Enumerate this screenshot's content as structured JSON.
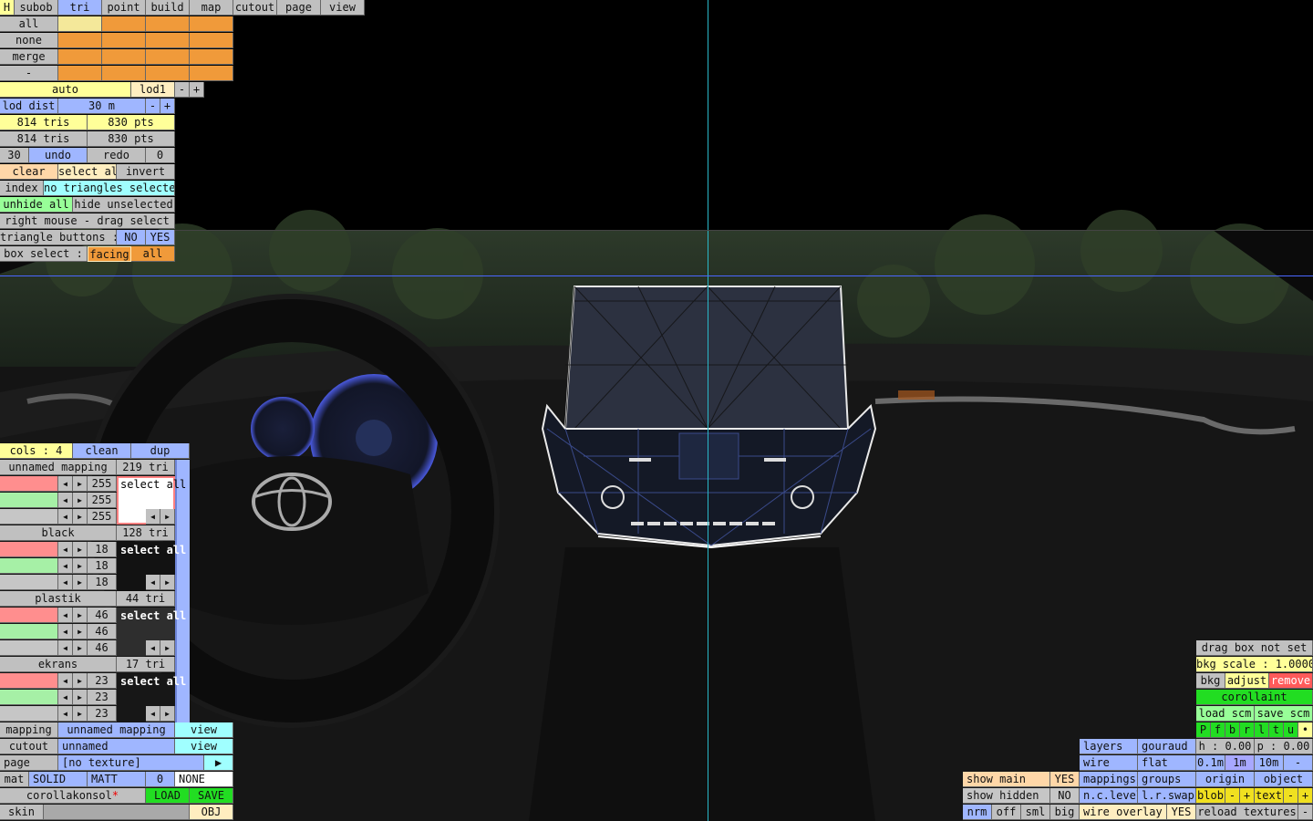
{
  "menu": {
    "h": "H",
    "subob": "subob",
    "tri": "tri",
    "point": "point",
    "build": "build",
    "map": "map",
    "cutout": "cutout",
    "page": "page",
    "view": "view"
  },
  "select_list": [
    "all",
    "none",
    "merge",
    "-"
  ],
  "lod": {
    "auto": "auto",
    "lod1": "lod1",
    "minus": "-",
    "plus": "+",
    "dist_label": "lod dist",
    "dist_value": "30 m"
  },
  "stats": {
    "tris1": "814 tris",
    "pts1": "830 pts",
    "tris2": "814 tris",
    "pts2": "830 pts"
  },
  "undo_row": {
    "left_count": "30",
    "undo": "undo",
    "redo": "redo",
    "right_count": "0"
  },
  "select_row": {
    "clear": "clear",
    "select_all": "select all",
    "invert": "invert"
  },
  "index_row": {
    "index": "index",
    "status": "no triangles selected"
  },
  "hide_row": {
    "unhide_all": "unhide all",
    "hide_unselected": "hide unselected"
  },
  "drag_hint": "right mouse - drag select",
  "tri_buttons": {
    "label": "triangle buttons :",
    "no": "NO",
    "yes": "YES"
  },
  "box_select": {
    "label": "box select :",
    "facing": "facing",
    "all": "all"
  },
  "cols_row": {
    "cols": "cols : 4",
    "clean": "clean",
    "dup": "dup"
  },
  "materials": [
    {
      "name": "unnamed mapping",
      "count": "219 tri",
      "r": "255",
      "g": "255",
      "b": "255",
      "swatch": "#ffffff",
      "select": "select all"
    },
    {
      "name": "black",
      "count": "128 tri",
      "r": "18",
      "g": "18",
      "b": "18",
      "swatch": "#121212",
      "select": "select all"
    },
    {
      "name": "plastik",
      "count": "44 tri",
      "r": "46",
      "g": "46",
      "b": "46",
      "swatch": "#2e2e2e",
      "select": "select all"
    },
    {
      "name": "ekrans",
      "count": "17 tri",
      "r": "23",
      "g": "23",
      "b": "23",
      "swatch": "#171717",
      "select": "select all"
    }
  ],
  "bottom_left": {
    "mapping_label": "mapping",
    "mapping_value": "unnamed mapping",
    "mapping_view": "view",
    "cutout_label": "cutout",
    "cutout_value": "unnamed",
    "cutout_view": "view",
    "page_label": "page",
    "page_value": "[no texture]",
    "page_arrow": "▶",
    "mat_label": "mat",
    "mat_solid": "SOLID",
    "mat_matt": "MATT",
    "mat_zero": "0",
    "mat_none": "NONE",
    "file_name": "corollakonsol",
    "file_star": "*",
    "load": "LOAD",
    "save": "SAVE",
    "skin": "skin",
    "obj": "OBJ"
  },
  "bottom_right": {
    "drag_box": "drag box not set",
    "bkg_scale": "bkg scale : 1.0000",
    "bkg": "bkg",
    "adjust": "adjust",
    "remove": "remove",
    "corollaint": "corollaint",
    "load_scm": "load scm",
    "save_scm": "save scm",
    "letters": [
      "P",
      "f",
      "b",
      "r",
      "l",
      "t",
      "u",
      "•"
    ],
    "layers": "layers",
    "gouraud": "gouraud",
    "h": "h : 0.00",
    "p": "p : 0.00",
    "wire": "wire",
    "flat": "flat",
    "s01": "0.1m",
    "s1": "1m",
    "s10": "10m",
    "sminus": "-",
    "show_main": "show main",
    "show_main_val": "YES",
    "mappings": "mappings",
    "groups": "groups",
    "origin": "origin",
    "object": "object",
    "show_hidden": "show hidden",
    "show_hidden_val": "NO",
    "nc_level": "n.c.level",
    "lr_swap": "l.r.swap",
    "blob": "blob",
    "blob_minus": "-",
    "blob_plus": "+",
    "text": "text",
    "text_minus": "-",
    "text_plus": "+",
    "nrm": "nrm",
    "off": "off",
    "sml": "sml",
    "big": "big",
    "wire_overlay": "wire overlay",
    "wire_overlay_val": "YES",
    "reload": "reload textures",
    "reload_minus": "-"
  },
  "colors": {
    "orange": "#f09a3a",
    "blue": "#9fb6ff",
    "yellow": "#ffff99",
    "green": "#22dd22",
    "cyan_line": "#20b0c0"
  }
}
